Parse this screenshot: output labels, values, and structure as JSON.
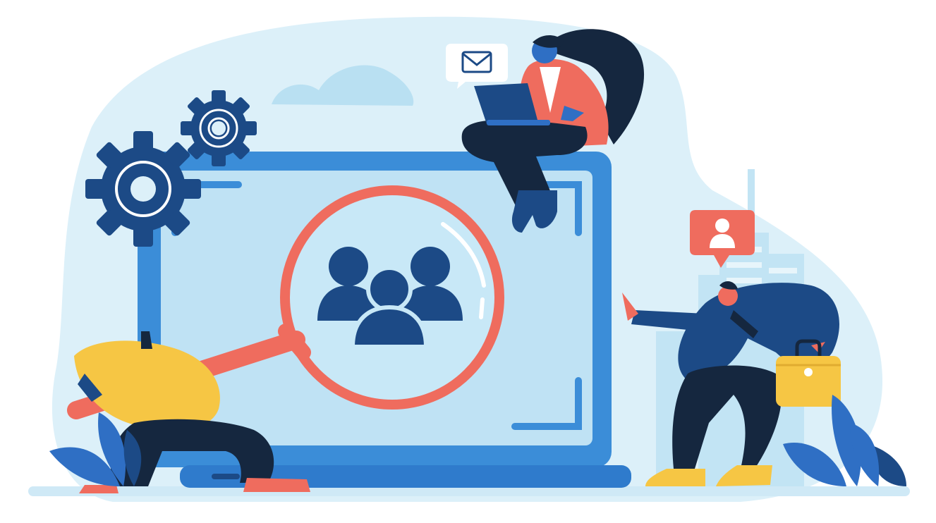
{
  "illustration": {
    "palette": {
      "background": "#ffffff",
      "blob_light": "#dcf0f9",
      "cloud": "#b9e0f2",
      "city": "#c2e4f4",
      "monitor_frame": "#3b8dd8",
      "monitor_screen": "#bfe2f4",
      "navy": "#1c4a86",
      "dark_navy": "#15273f",
      "coral": "#ef6c5e",
      "yellow": "#f6c644",
      "white": "#ffffff",
      "plant": "#2f6fc4"
    },
    "icons": [
      "gear-icon-large",
      "gear-icon-small",
      "mail-envelope-icon",
      "team-group-icon",
      "user-profile-badge-icon",
      "magnifying-glass-icon",
      "briefcase-icon",
      "laptop-icon"
    ]
  }
}
